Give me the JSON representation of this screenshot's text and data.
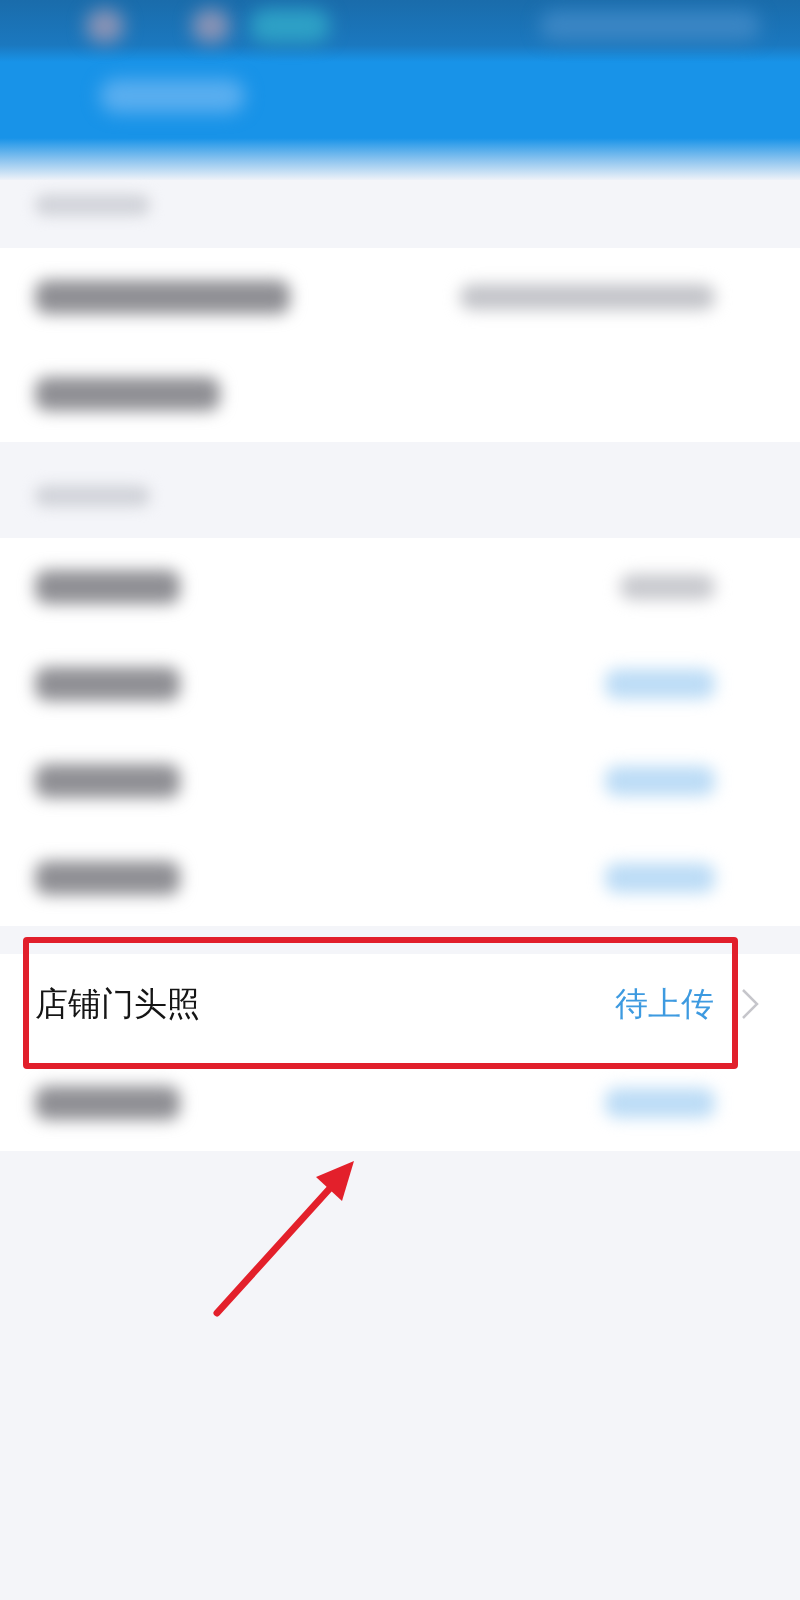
{
  "app_bar": {
    "kind": "blurred"
  },
  "sections": [
    {
      "header": {
        "kind": "blurred"
      },
      "rows": [
        {
          "kind": "blurred",
          "label_bar": {
            "kind": "long"
          },
          "value_bar": {
            "kind": "wide"
          }
        },
        {
          "kind": "blurred",
          "label_bar": {
            "kind": "medium"
          }
        }
      ]
    },
    {
      "header": {
        "kind": "blurred"
      },
      "rows": [
        {
          "kind": "blurred",
          "label_bar": {
            "kind": "short"
          },
          "value_bar": {
            "kind": "narrow"
          }
        },
        {
          "kind": "blurred",
          "label_bar": {
            "kind": "short"
          },
          "value_bar": {
            "kind": "badge"
          }
        },
        {
          "kind": "blurred",
          "label_bar": {
            "kind": "short"
          },
          "value_bar": {
            "kind": "badge"
          }
        },
        {
          "kind": "blurred",
          "label_bar": {
            "kind": "short"
          },
          "value_bar": {
            "kind": "badge"
          }
        }
      ]
    },
    {
      "rows": [
        {
          "kind": "item",
          "label": "店铺门头照",
          "value": "待上传",
          "highlighted": true
        },
        {
          "kind": "blurred",
          "label_bar": {
            "kind": "short"
          },
          "value_bar": {
            "kind": "badge"
          }
        }
      ]
    }
  ],
  "pointer_arrow": true
}
